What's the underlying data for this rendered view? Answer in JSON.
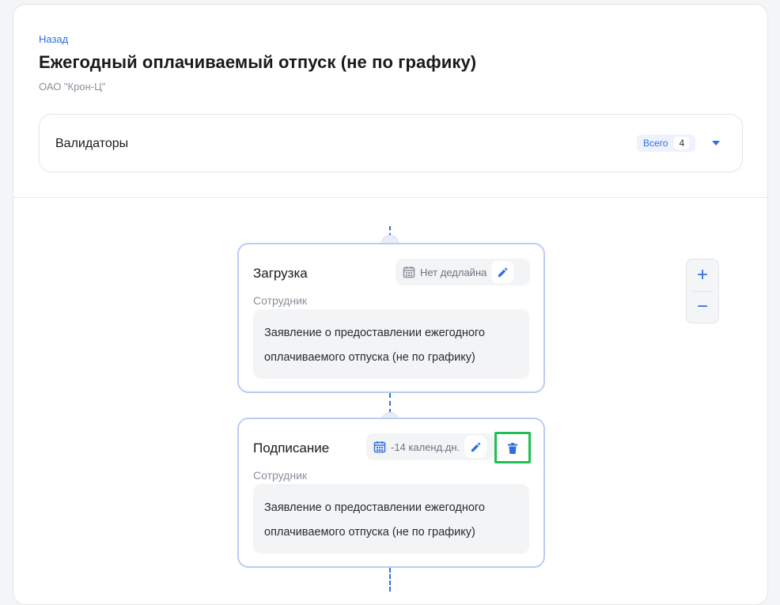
{
  "header": {
    "back_label": "Назад",
    "title": "Ежегодный оплачиваемый отпуск (не по графику)",
    "organization": "ОАО \"Крон-Ц\""
  },
  "validators": {
    "label": "Валидаторы",
    "total_label": "Всего",
    "total_count": "4"
  },
  "steps": [
    {
      "title": "Загрузка",
      "deadline": "Нет дедлайна",
      "role": "Сотрудник",
      "document": "Заявление о предоставлении ежегодного оплачиваемого отпуска (не по графику)"
    },
    {
      "title": "Подписание",
      "deadline": "-14 календ.дн.",
      "role": "Сотрудник",
      "document": "Заявление о предоставлении ежегодного оплачиваемого отпуска (не по графику)"
    }
  ],
  "zoom": {
    "in_label": "+",
    "out_label": "−"
  },
  "colors": {
    "accent": "#2f6fe0",
    "highlight": "#1fbf55",
    "card_border": "#b9cdf3"
  }
}
